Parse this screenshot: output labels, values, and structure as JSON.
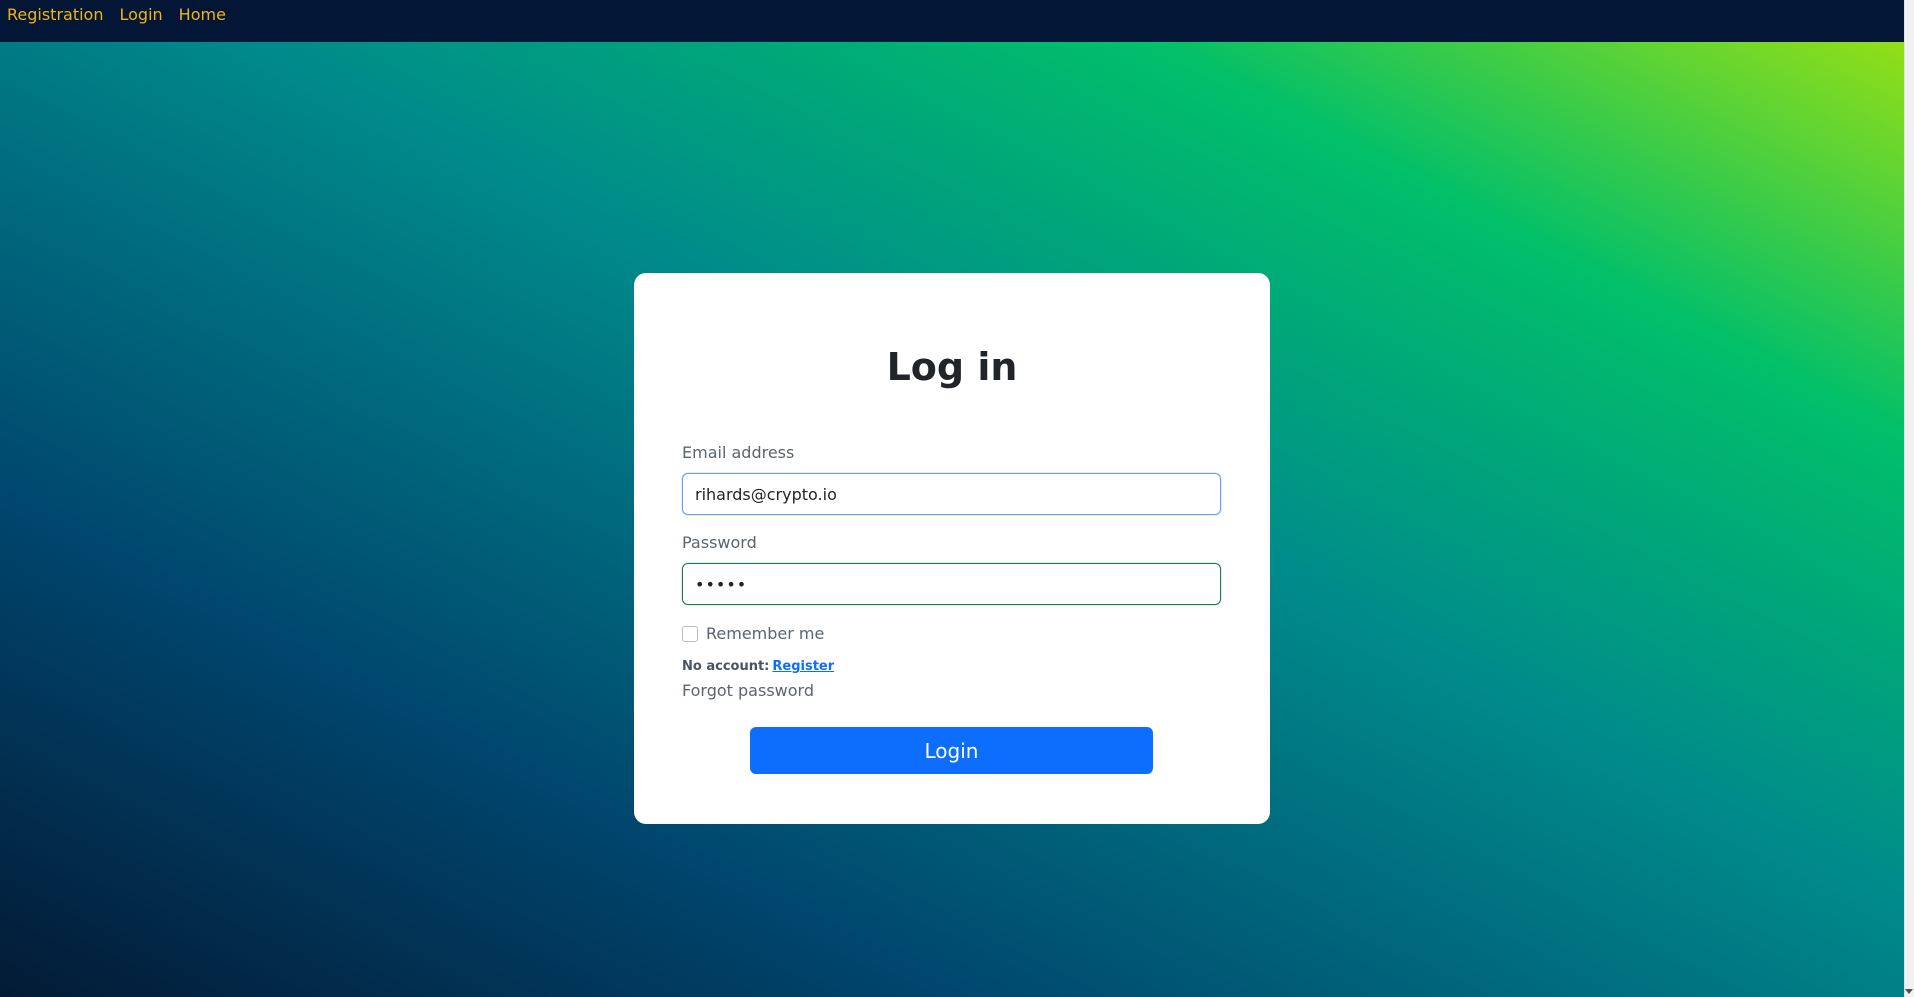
{
  "nav": {
    "links": [
      "Registration",
      "Login",
      "Home"
    ]
  },
  "login_form": {
    "title": "Log in",
    "email_label": "Email address",
    "email_value": "rihards@crypto.io",
    "password_label": "Password",
    "password_value": "•••••",
    "remember_label": "Remember me",
    "remember_checked": false,
    "no_account_text": "No account:",
    "register_link": "Register",
    "forgot_password": "Forgot password",
    "submit_label": "Login"
  },
  "colors": {
    "nav_bg": "#031636",
    "nav_link": "#f0b41a",
    "primary": "#0d6efd",
    "gradient": [
      "#031a35",
      "#00466e",
      "#008b8b",
      "#01bf6a",
      "#a3e20d"
    ]
  }
}
